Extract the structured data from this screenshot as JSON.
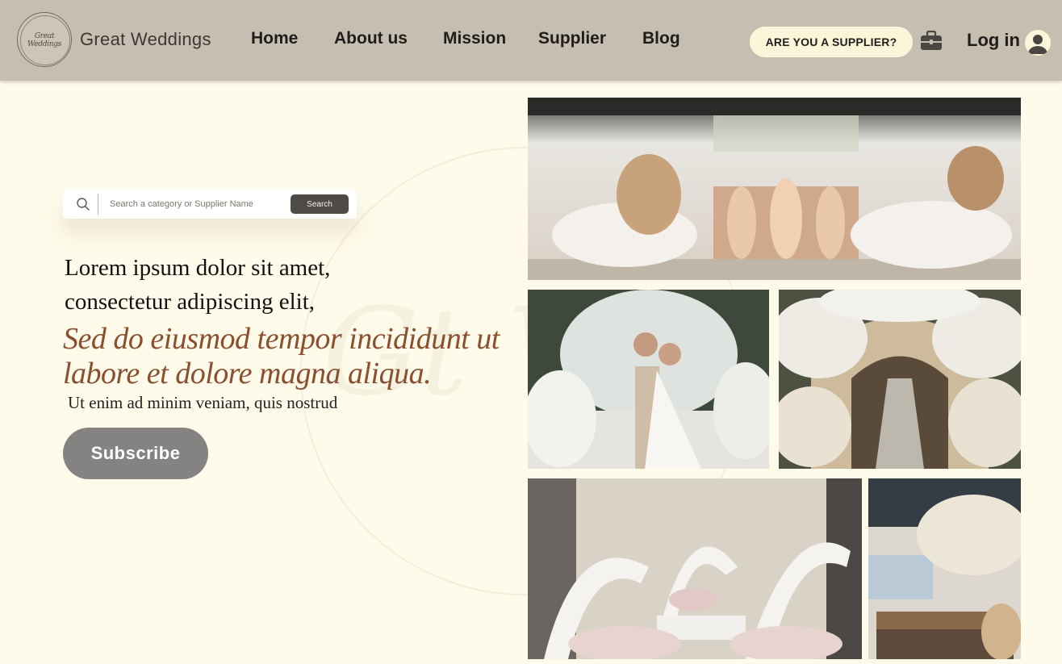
{
  "header": {
    "logo_text": "Great Weddings",
    "brand_name": "Great Weddings",
    "nav": [
      "Home",
      "About us",
      "Mission",
      "Supplier",
      "Blog"
    ],
    "supplier_cta": "ARE YOU A SUPPLIER?",
    "login_label": "Log in",
    "icons": [
      "briefcase-icon",
      "user-avatar-icon"
    ]
  },
  "search": {
    "placeholder": "Search a category or Supplier Name",
    "button_label": "Search",
    "icon": "search-icon"
  },
  "hero": {
    "line1": "Lorem ipsum dolor sit amet,",
    "line2": "consectetur adipiscing elit,",
    "accent_line1": "Sed do eiusmod tempor incididunt ut",
    "accent_line2": "labore et dolore magna aliqua.",
    "subline": "Ut enim ad minim veniam, quis nostrud",
    "subscribe_label": "Subscribe"
  },
  "colors": {
    "page_background": "#fefbea",
    "header_background": "#c6beb1",
    "cta_background": "#fcf5da",
    "accent_text": "#8b4f2f",
    "subscribe_button": "#858381",
    "search_button": "#4f4c48"
  }
}
